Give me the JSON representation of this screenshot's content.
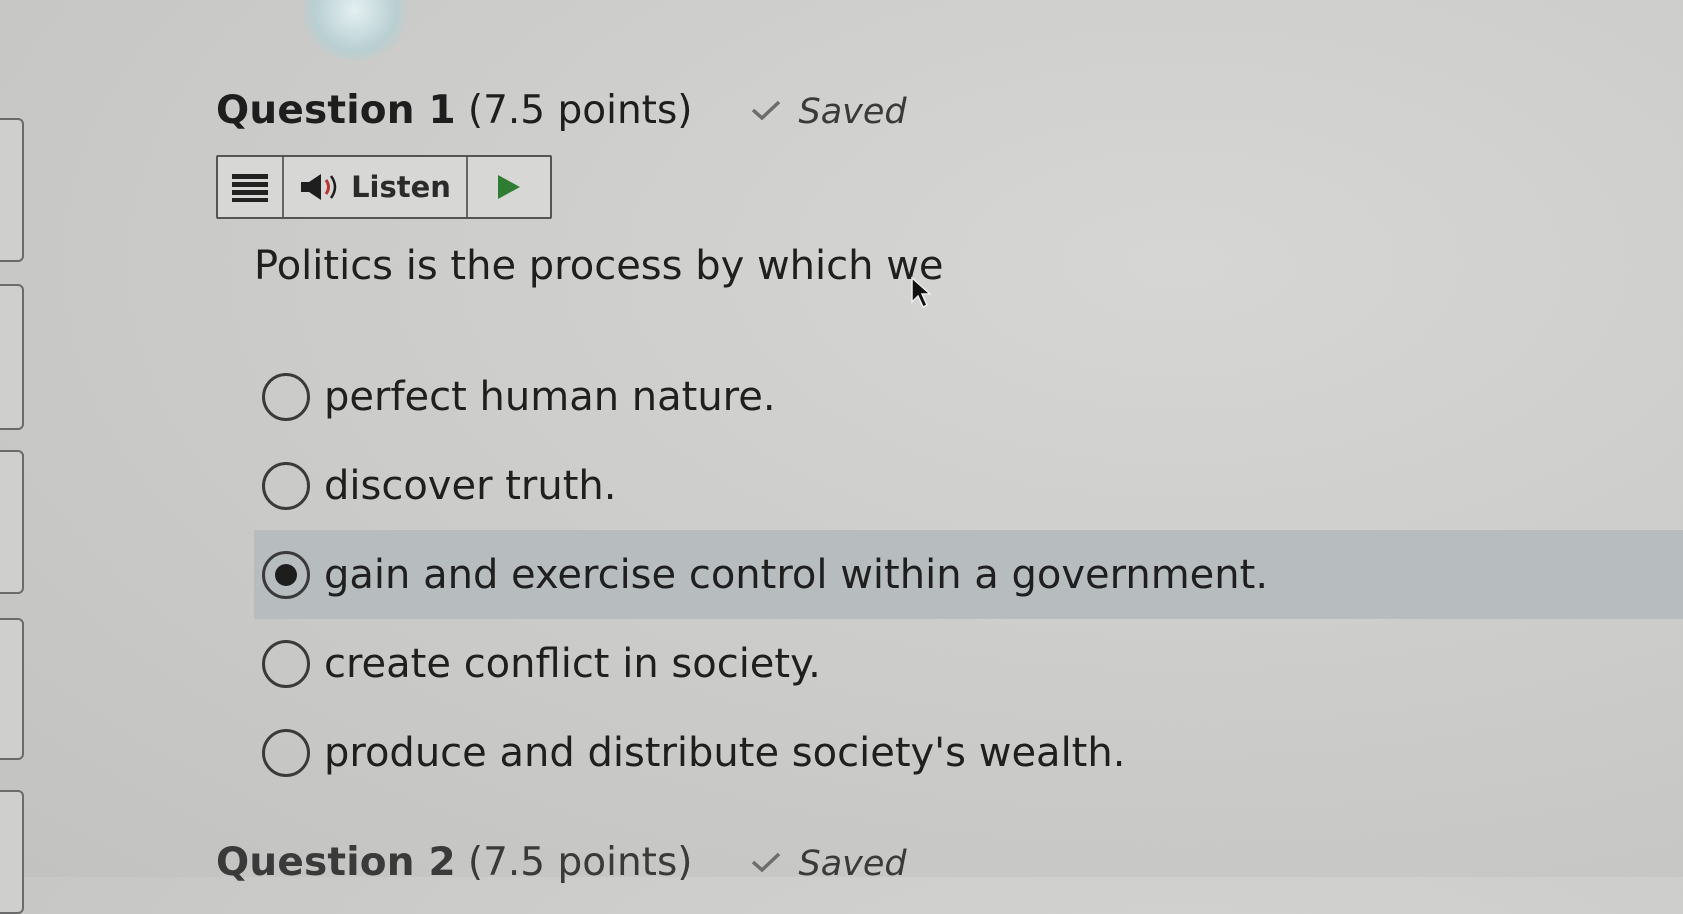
{
  "question": {
    "title": "Question 1",
    "points": "(7.5 points)",
    "status": "Saved",
    "prompt": "Politics is the process by which we"
  },
  "toolbar": {
    "listen_label": "Listen"
  },
  "options": [
    {
      "label": "perfect human nature.",
      "selected": false
    },
    {
      "label": "discover truth.",
      "selected": false
    },
    {
      "label": "gain and exercise control within a government.",
      "selected": true
    },
    {
      "label": "create conflict in society.",
      "selected": false
    },
    {
      "label": "produce and distribute society's wealth.",
      "selected": false
    }
  ],
  "next_question": {
    "title": "Question 2",
    "points": "(7.5 points)",
    "status": "Saved"
  },
  "colors": {
    "selected_row": "#b7bcbf",
    "play_icon": "#2e7d32"
  },
  "icons": [
    "menu-icon",
    "speaker-icon",
    "play-icon",
    "check-icon",
    "mouse-cursor-icon"
  ]
}
